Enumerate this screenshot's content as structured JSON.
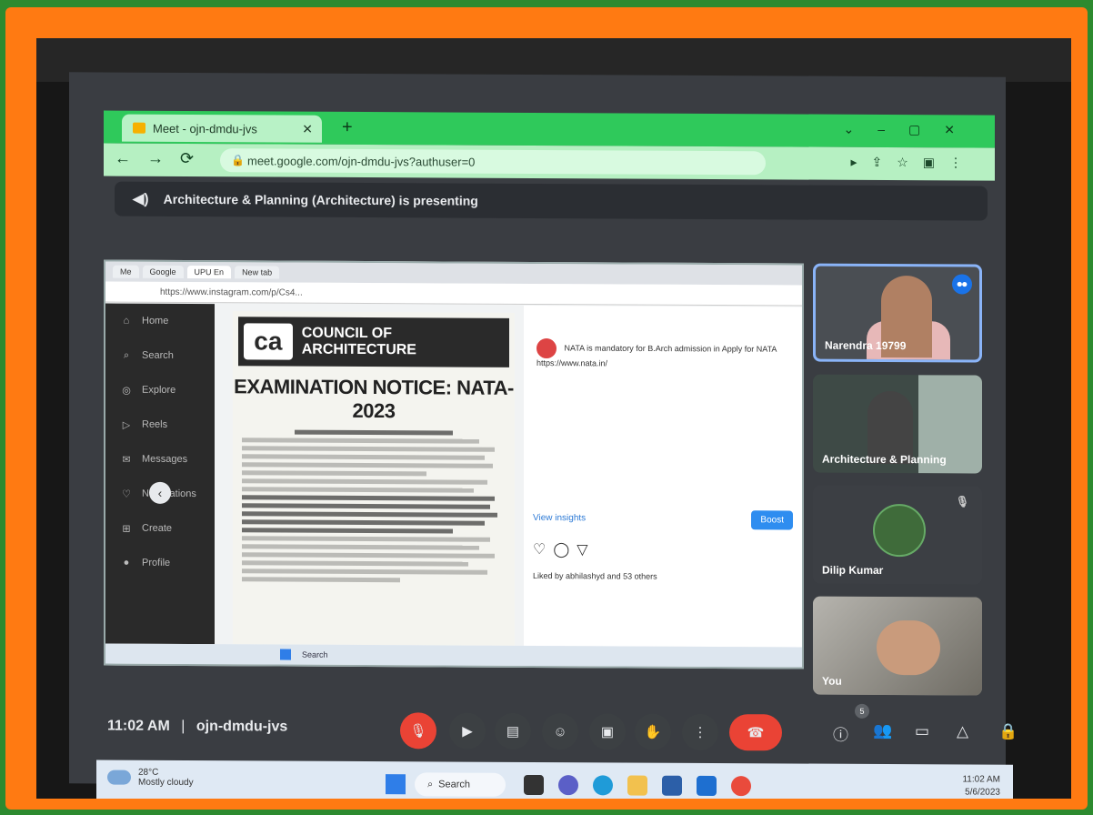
{
  "browser": {
    "tab_title": "Meet - ojn-dmdu-jvs",
    "url": "meet.google.com/ojn-dmdu-jvs?authuser=0"
  },
  "banner": {
    "text": "Architecture & Planning (Architecture) is presenting"
  },
  "shared_screen": {
    "tabs": [
      "Me",
      "Google",
      "UPU En",
      "New tab"
    ],
    "url": "https://www.instagram.com/p/Cs4...",
    "ig_sidebar": [
      "Home",
      "Search",
      "Explore",
      "Reels",
      "Messages",
      "Notifications",
      "Create",
      "Profile"
    ],
    "doc": {
      "org": "COUNCIL OF ARCHITECTURE",
      "logo": "ca",
      "notice": "EXAMINATION NOTICE: NATA-2023"
    },
    "post": {
      "comment": "NATA is mandatory for B.Arch admission in Apply for NATA https://www.nata.in/",
      "view_insights": "View insights",
      "boost": "Boost",
      "liked_by": "Liked by abhilashyd and 53 others"
    },
    "taskbar_search": "Search"
  },
  "participants": [
    {
      "name": "Narendra 19799"
    },
    {
      "name": "Architecture & Planning"
    },
    {
      "name": "Dilip Kumar"
    },
    {
      "name": "You"
    }
  ],
  "meeting": {
    "time": "11:02 AM",
    "separator": "|",
    "code": "ojn-dmdu-jvs",
    "people_count": "5"
  },
  "taskbar": {
    "temp": "28°C",
    "weather": "Mostly cloudy",
    "search": "Search",
    "clock_time": "11:02 AM",
    "clock_date": "5/6/2023"
  },
  "colors": {
    "frame": "#ff7a12",
    "chrome": "#2fc95b",
    "end_call": "#ea4335",
    "active_speaker": "#8ab4f8"
  }
}
